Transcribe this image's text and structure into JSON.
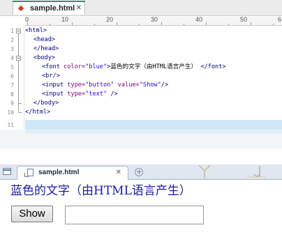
{
  "editor": {
    "tab": {
      "title": "sample.html",
      "icon": "html-file-diamond-icon",
      "close": "✕"
    },
    "ruler": {
      "labels": [
        "0",
        "10",
        "20",
        "30",
        "40",
        "50",
        "6"
      ]
    },
    "line_numbers": [
      "1",
      "2",
      "3",
      "4",
      "5",
      "6",
      "7",
      "8",
      "9",
      "10",
      "11"
    ],
    "code": {
      "l1": "<html>",
      "l2": "<head>",
      "l3": "</head>",
      "l4": "<body>",
      "l5_open": "<font ",
      "l5_attr": "color=",
      "l5_val": "\"blue\"",
      "l5_close": ">",
      "l5_text": "蓝色的文字（由HTML语言产生）",
      "l5_end": " </font>",
      "l6": "<br/>",
      "l7_open": "<input ",
      "l7_attr1": "type=",
      "l7_val1": "\"button\"",
      "l7_attr2": " value=",
      "l7_val2": "\"Show\"",
      "l7_end": "/>",
      "l8_open": "<input ",
      "l8_attr": "type=",
      "l8_val": "\"text\"",
      "l8_end": " />",
      "l9": "</body>",
      "l10": "</html>"
    }
  },
  "browser": {
    "tab": {
      "title": "sample.html",
      "close": "✕"
    },
    "page": {
      "heading": "蓝色的文字（由HTML语言产生）",
      "button_value": "Show",
      "text_input_value": ""
    }
  },
  "colors": {
    "tag": "#000080",
    "attribute": "#7f007f",
    "attribute_value": "#2a00ff",
    "rendered_text_blue": "#1b1b9a",
    "editor_tab_accent": "#3d8f7c"
  }
}
